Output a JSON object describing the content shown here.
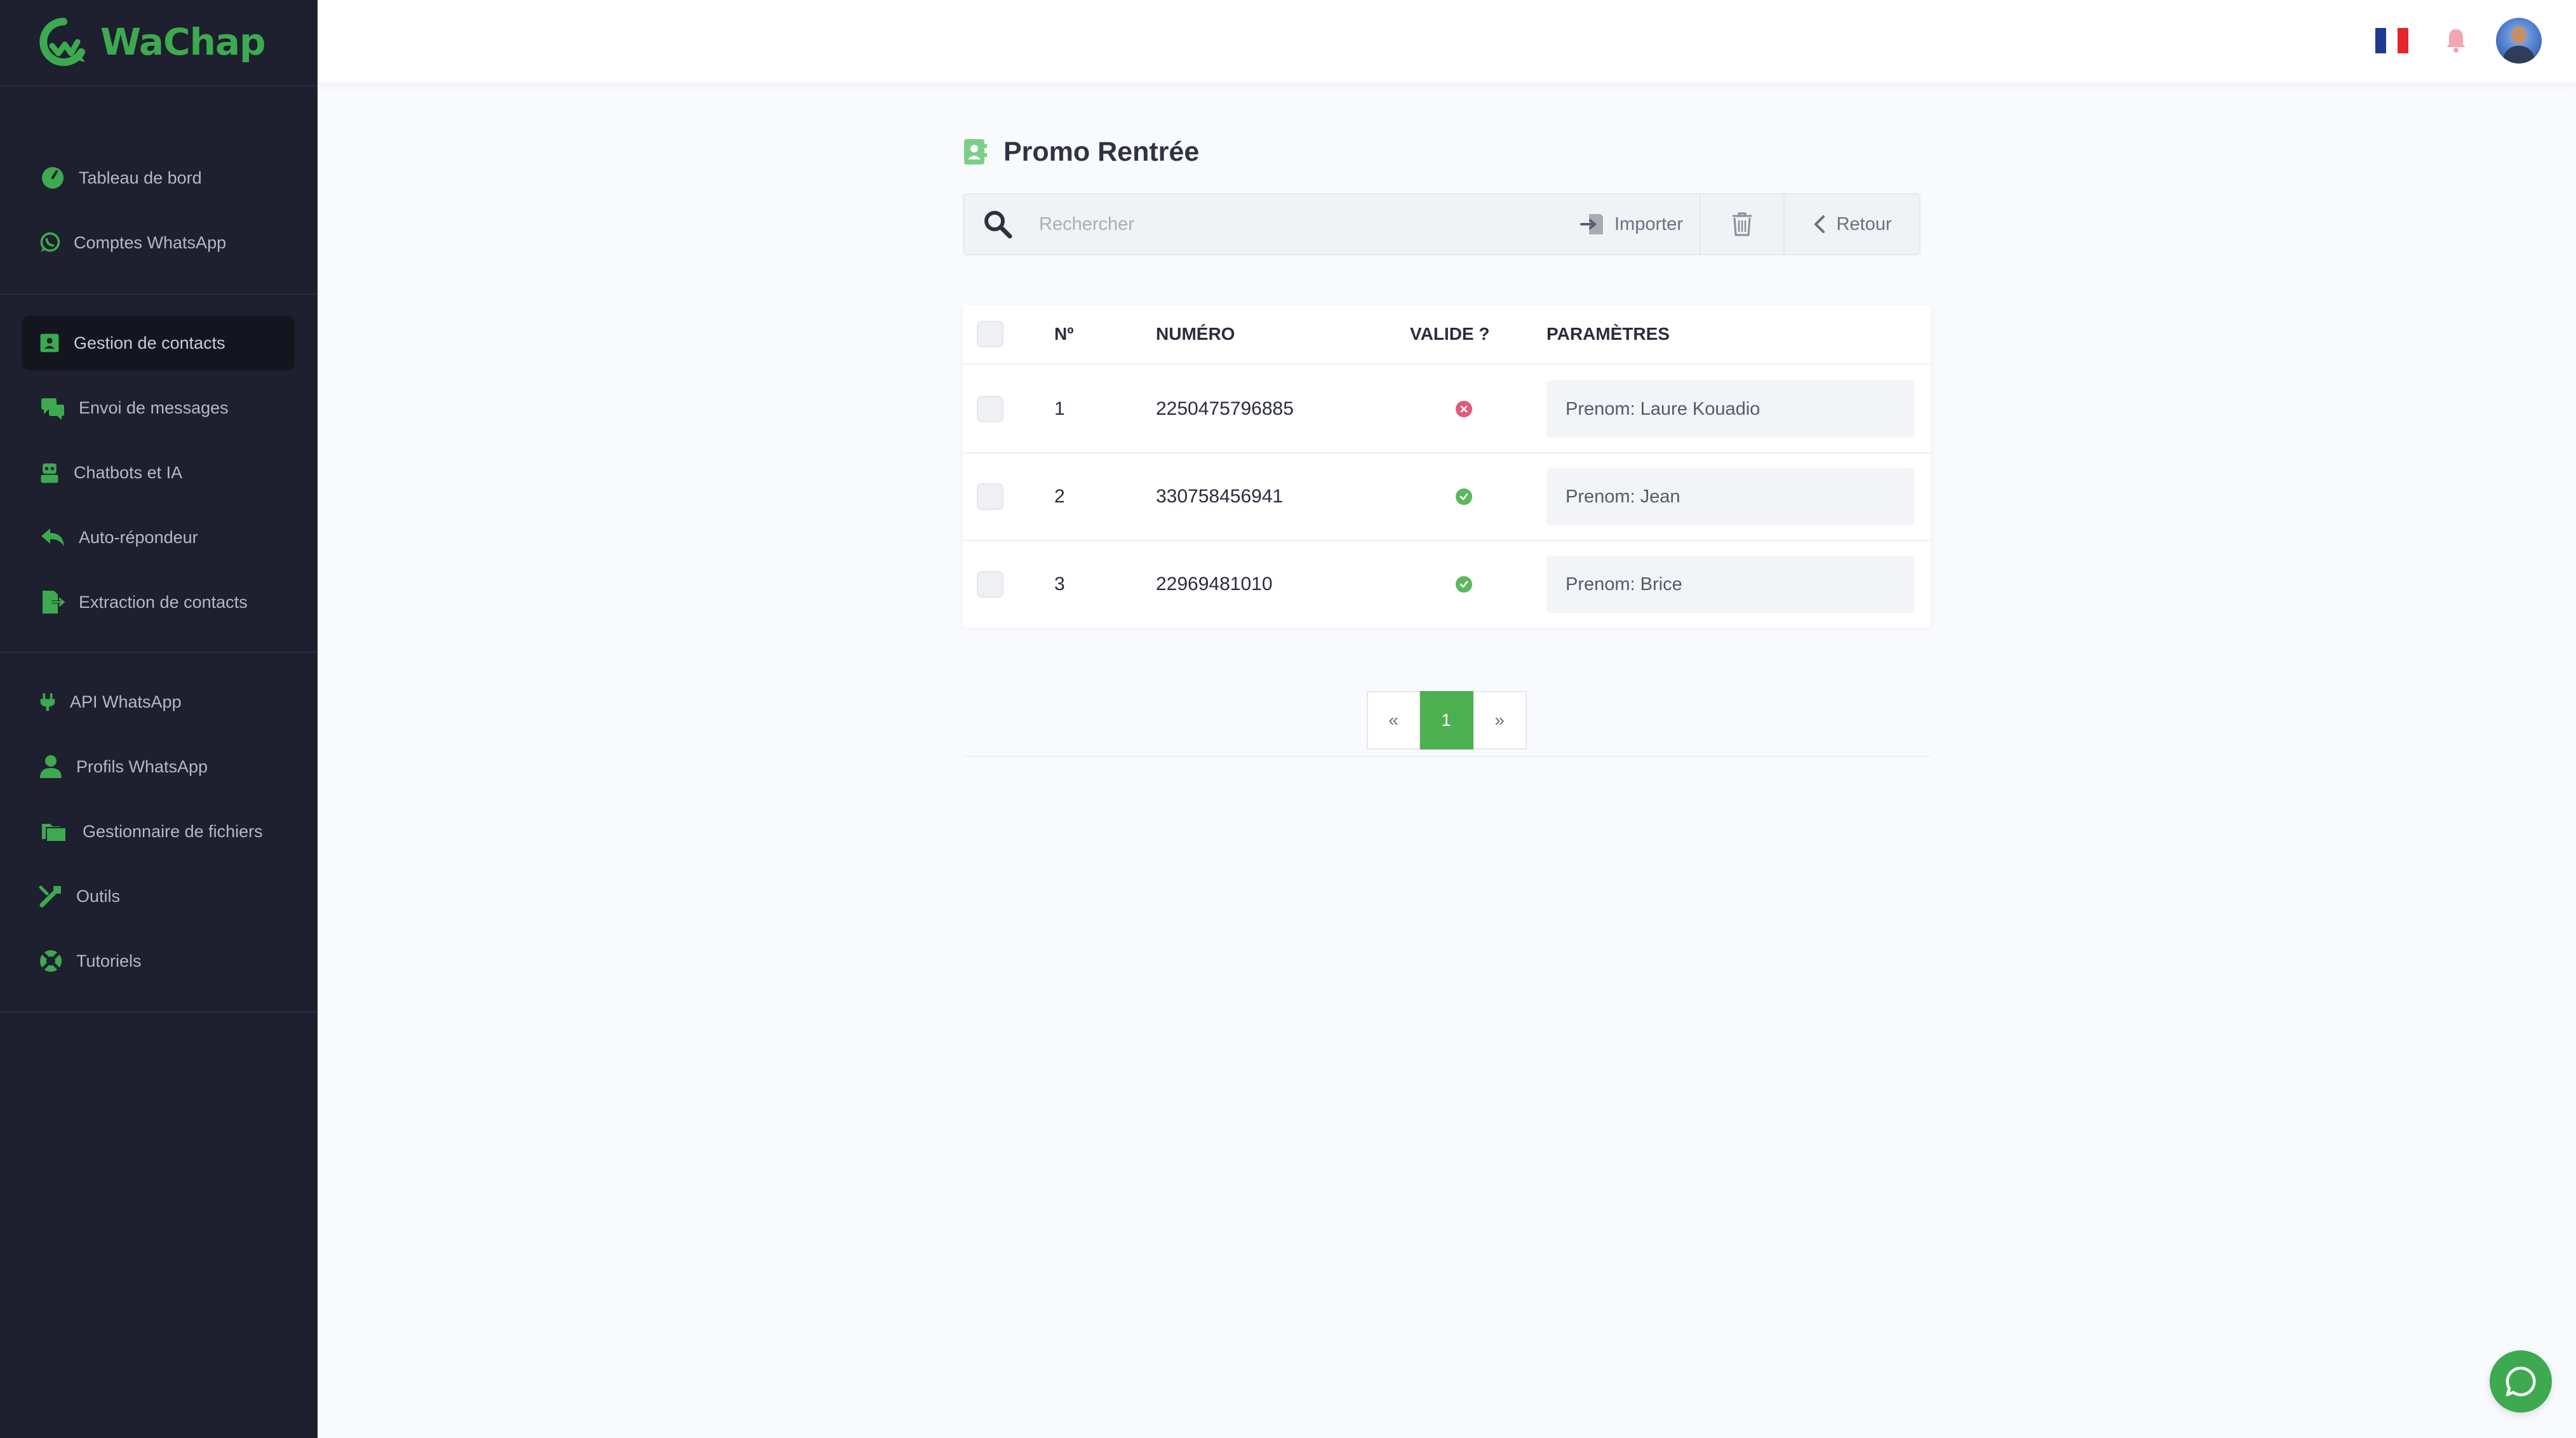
{
  "app": {
    "name": "WaChap"
  },
  "sidebar": {
    "groups": [
      [
        {
          "label": "Tableau de bord",
          "icon": "gauge-icon"
        },
        {
          "label": "Comptes WhatsApp",
          "icon": "whatsapp-icon"
        }
      ],
      [
        {
          "label": "Gestion de contacts",
          "icon": "contact-card-icon",
          "active": true
        },
        {
          "label": "Envoi de messages",
          "icon": "comments-icon"
        },
        {
          "label": "Chatbots et IA",
          "icon": "robot-icon"
        },
        {
          "label": "Auto-répondeur",
          "icon": "reply-icon"
        },
        {
          "label": "Extraction de contacts",
          "icon": "file-export-icon"
        }
      ],
      [
        {
          "label": "API WhatsApp",
          "icon": "plug-icon"
        },
        {
          "label": "Profils WhatsApp",
          "icon": "user-icon"
        },
        {
          "label": "Gestionnaire de fichiers",
          "icon": "folder-icon"
        },
        {
          "label": "Outils",
          "icon": "tools-icon"
        },
        {
          "label": "Tutoriels",
          "icon": "life-ring-icon"
        }
      ]
    ]
  },
  "header": {
    "language": "fr",
    "flag_icon": "france-flag-icon"
  },
  "page": {
    "title": "Promo Rentrée"
  },
  "toolbar": {
    "search_placeholder": "Rechercher",
    "import_label": "Importer",
    "back_label": "Retour"
  },
  "table": {
    "headers": {
      "select": "",
      "number": "Nº",
      "phone": "NUMÉRO",
      "valid": "VALIDE ?",
      "params": "PARAMÈTRES"
    },
    "rows": [
      {
        "index": "1",
        "phone": "2250475796885",
        "valid": false,
        "params": "Prenom: Laure Kouadio"
      },
      {
        "index": "2",
        "phone": "330758456941",
        "valid": true,
        "params": "Prenom: Jean"
      },
      {
        "index": "3",
        "phone": "22969481010",
        "valid": true,
        "params": "Prenom: Brice"
      }
    ]
  },
  "pagination": {
    "prev": "«",
    "current": "1",
    "next": "»"
  },
  "colors": {
    "brand": "#3daa50",
    "sidebar_bg": "#1e1f2f",
    "valid": "#5cb85c",
    "invalid": "#e2597a"
  }
}
